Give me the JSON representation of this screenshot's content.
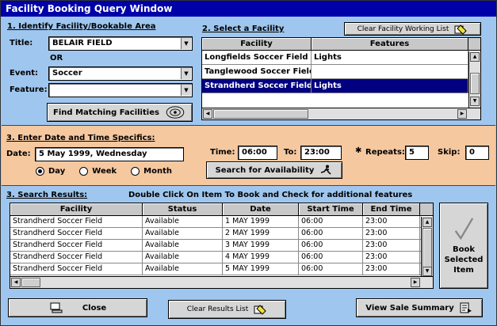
{
  "window": {
    "title": "Facility Booking Query Window"
  },
  "section1": {
    "title": "1. Identify Facility/Bookable Area",
    "title_label": "Title:",
    "title_value": "BELAIR FIELD",
    "or_label": "OR",
    "event_label": "Event:",
    "event_value": "Soccer",
    "feature_label": "Feature:",
    "feature_value": "",
    "find_button": "Find Matching Facilities"
  },
  "section2": {
    "title": "2. Select a Facility",
    "clear_button": "Clear Facility Working List",
    "columns": [
      "Facility",
      "Features"
    ],
    "rows": [
      {
        "facility": "Longfields Soccer Field",
        "features": "Lights",
        "selected": false
      },
      {
        "facility": "Tanglewood Soccer Field",
        "features": "",
        "selected": false
      },
      {
        "facility": "Strandherd Soccer Field",
        "features": "Lights",
        "selected": true
      }
    ]
  },
  "section3": {
    "title": "3. Enter Date and Time Specifics:",
    "date_label": "Date:",
    "date_value": "5 May 1999, Wednesday",
    "time_label": "Time:",
    "time_from": "06:00",
    "to_label": "To:",
    "time_to": "23:00",
    "repeats_label": "Repeats:",
    "repeats_value": "5",
    "skip_label": "Skip:",
    "skip_value": "0",
    "radios": [
      {
        "label": "Day",
        "checked": true
      },
      {
        "label": "Week",
        "checked": false
      },
      {
        "label": "Month",
        "checked": false
      }
    ],
    "search_button": "Search for Availability"
  },
  "results": {
    "title": "3. Search Results:",
    "hint": "Double Click On Item To Book and Check for additional features",
    "columns": [
      "Facility",
      "Status",
      "Date",
      "Start Time",
      "End Time"
    ],
    "rows": [
      [
        "Strandherd Soccer Field",
        "Available",
        "1 MAY 1999",
        "06:00",
        "23:00"
      ],
      [
        "Strandherd Soccer Field",
        "Available",
        "2 MAY 1999",
        "06:00",
        "23:00"
      ],
      [
        "Strandherd Soccer Field",
        "Available",
        "3 MAY 1999",
        "06:00",
        "23:00"
      ],
      [
        "Strandherd Soccer Field",
        "Available",
        "4 MAY 1999",
        "06:00",
        "23:00"
      ],
      [
        "Strandherd Soccer Field",
        "Available",
        "5 MAY 1999",
        "06:00",
        "23:00"
      ]
    ],
    "book_button": "Book Selected Item"
  },
  "footer": {
    "close_button": "Close",
    "clear_results_button": "Clear Results List",
    "sale_summary_button": "View Sale Summary"
  },
  "colors": {
    "background": "#9fc6ee",
    "section3_bg": "#f5c8a0",
    "titlebar": "#0000a8",
    "selection": "#000080"
  }
}
